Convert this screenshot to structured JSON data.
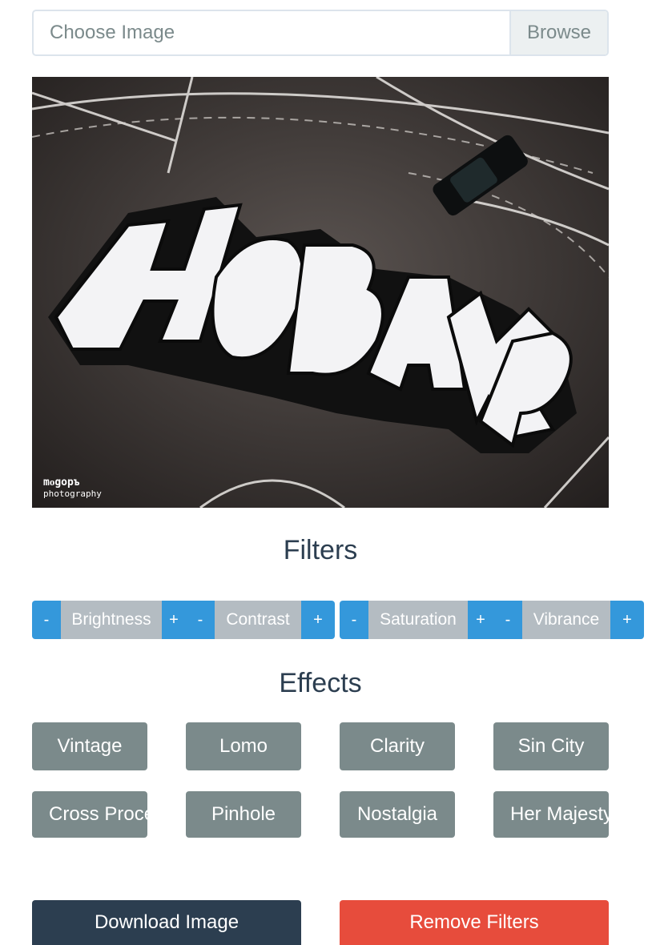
{
  "file_input": {
    "placeholder": "Choose Image",
    "browse_label": "Browse"
  },
  "photo": {
    "watermark_line1": "mᴏgopъ",
    "watermark_line2": "photography"
  },
  "filters": {
    "title": "Filters",
    "items": [
      {
        "minus": "-",
        "label": "Brightness",
        "plus": "+"
      },
      {
        "minus": "-",
        "label": "Contrast",
        "plus": "+"
      },
      {
        "minus": "-",
        "label": "Saturation",
        "plus": "+"
      },
      {
        "minus": "-",
        "label": "Vibrance",
        "plus": "+"
      }
    ]
  },
  "effects": {
    "title": "Effects",
    "items": [
      "Vintage",
      "Lomo",
      "Clarity",
      "Sin City",
      "Cross Process",
      "Pinhole",
      "Nostalgia",
      "Her Majesty"
    ]
  },
  "actions": {
    "download_label": "Download Image",
    "remove_label": "Remove Filters"
  },
  "colors": {
    "primary": "#3498db",
    "dark": "#2c3e50",
    "danger": "#e74c3c",
    "gray": "#7b8a8b",
    "light_gray": "#b4bcc2"
  }
}
